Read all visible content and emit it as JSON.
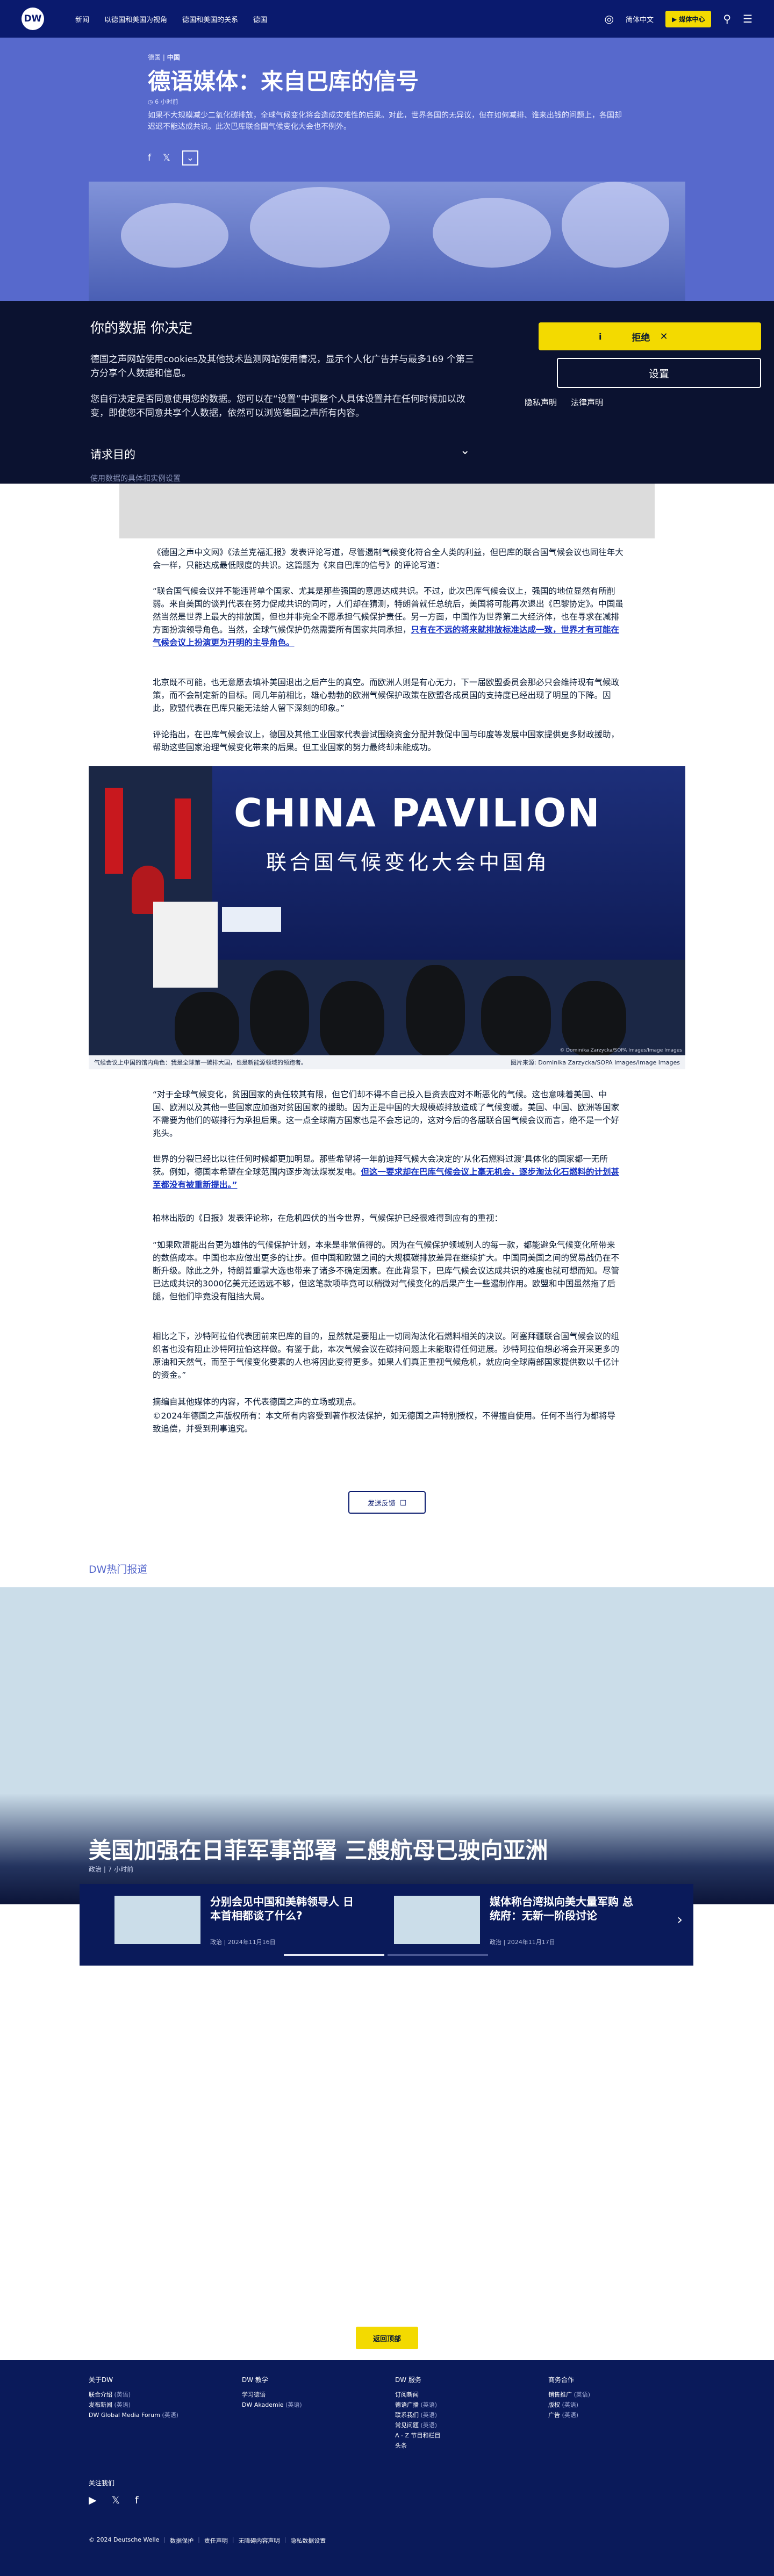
{
  "header": {
    "logo": "DW",
    "nav": [
      "新闻",
      "以德国和美国为视角",
      "德国和美国的关系",
      "德国"
    ],
    "lang_label": "简体中文",
    "media_center": "媒体中心"
  },
  "article": {
    "breadcrumb_section": "德国",
    "breadcrumb_region": "中国",
    "title": "德语媒体：来自巴库的信号",
    "time_ago": "6 小时前",
    "lead": "如果不大规模减少二氧化碳排放，全球气候变化将会造成灾难性的后果。对此，世界各国的无异议，但在如何减排、谁来出钱的问题上，各国却迟迟不能达成共识。此次巴库联合国气候变化大会也不例外。",
    "share_more": "更多",
    "para1": "《德国之声中文网》《法兰克福汇报》发表评论写道，尽管遏制气候变化符合全人类的利益，但巴库的联合国气候会议也同往年大会一样，只能达成最低限度的共识。这篇题为《来自巴库的信号》的评论写道：",
    "para2": "“联合国气候会议并不能违背单个国家、尤其是那些强国的意愿达成共识。不过，此次巴库气候会议上，强国的地位显然有所削弱。来自美国的谈判代表在努力促成共识的同时，人们却在猜测，特朗普就任总统后，美国将可能再次退出《巴黎协定》。中国虽然当然是世界上最大的排放国，但也并非完全不愿承担气候保护责任。另一方面，中国作为世界第二大经济体，也在寻求在减排方面扮演领导角色。当然，全球气候保护仍然需要所有国家共同承担，",
    "para2_link": "只有在不远的将来就排放标准达成一致，世界才有可能在气候会议上扮演更为开明的主导角色。",
    "para3": "北京既不可能，也无意愿去填补美国退出之后产生的真空。而欧洲人则是有心无力，下一届欧盟委员会那必只会维持现有气候政策，而不会制定新的目标。同几年前相比，雄心勃勃的欧洲气候保护政策在欧盟各成员国的支持度已经出现了明显的下降。因此，欧盟代表在巴库只能无法给人留下深刻的印象。”",
    "para4": "评论指出，在巴库气候会议上，德国及其他工业国家代表尝试围绕资金分配并敦促中国与印度等发展中国家提供更多财政援助，帮助这些国家治理气候变化带来的后果。但工业国家的努力最终却未能成功。",
    "photo_caption": "气候会议上中国的馆内角色：我是全球第一碳排大国，也是新能源领域的领跑者。",
    "photo_credit": "图片来源: Dominika Zarzycka/SOPA Images/Image Images",
    "image_credit_overlay": "© Dominika Zarzycka/SOPA Images/Image Images",
    "pavilion_title": "CHINA PAVILION",
    "pavilion_sub": "联合国气候变化大会中国角",
    "para5": "“对于全球气候变化，贫困国家的责任较其有限，但它们却不得不自己投入巨资去应对不断恶化的气候。这也意味着美国、中国、欧洲以及其他一些国家应加强对贫困国家的援助。因为正是中国的大规模碳排放造成了气候变暖。美国、中国、欧洲等国家不需要为他们的碳排行为承担后果。这一点全球南方国家也是不会忘记的，这对今后的各届联合国气候会议而言，绝不是一个好兆头。",
    "para6": "世界的分裂已经比以往任何时候都更加明显。那些希望将一年前迪拜气候大会决定的‘从化石燃料过渡’具体化的国家都一无所获。例如，德国本希望在全球范围内逐步淘汰煤炭发电。",
    "para6_link": "但这一要求却在巴库气候会议上毫无机会，逐步淘汰化石燃料的计划甚至都没有被重新提出。”",
    "para7": "柏林出版的《日报》发表评论称，在危机四伏的当今世界，气候保护已经很难得到应有的重视：",
    "para8": "“如果欧盟能出台更为雄伟的气候保护计划，本来是非常值得的。因为在气候保护领域别人的每一款，都能避免气候变化所带来的数倍成本。中国也本应做出更多的让步。但中国和欧盟之间的大规模碳排放差异在继续扩大。中国同美国之间的贸易战仍在不断升级。除此之外，特朗普重掌大选也带来了诸多不确定因素。在此背景下，巴库气候会议达成共识的难度也就可想而知。尽管已达成共识的3000亿美元还远远不够，但这笔款项毕竟可以稍微对气候变化的后果产生一些遏制作用。欧盟和中国虽然拖了后腿，但他们毕竟没有阻挡大局。",
    "para9": "相比之下，沙特阿拉伯代表团前来巴库的目的，显然就是要阻止一切同淘汰化石燃料相关的决议。阿塞拜疆联合国气候会议的组织者也没有阻止沙特阿拉伯这样做。有鉴于此，本次气候会议在碳排问题上未能取得任何进展。沙特阿拉伯想必将会开采更多的原油和天然气，而至于气候变化要素的人也将因此变得更多。如果人们真正重视气候危机，就应向全球南部国家提供数以千亿计的资金。”",
    "para10": "摘编自其他媒体的内容，不代表德国之声的立场或观点。",
    "copyright": "©2024年德国之声版权所有：本文所有内容受到著作权法保护，如无德国之声特别授权，不得擅自使用。任何不当行为都将导致追偿，并受到刑事追究。",
    "feedback_label": "发送反馈"
  },
  "hot": {
    "section_title": "DW热门报道",
    "headline": "美国加强在日菲军事部署 三艘航母已驶向亚洲",
    "meta": "政治 | 7 小时前",
    "cards": [
      {
        "title": "分别会见中国和美韩领导人 日本首相都谈了什么?",
        "meta": "政治 | 2024年11月16日"
      },
      {
        "title": "媒体称台湾拟向美大量军购 总统府：无新一阶段讨论",
        "meta": "政治 | 2024年11月17日"
      }
    ]
  },
  "back_to_top": "返回顶部",
  "cookie": {
    "title": "你的数据 你决定",
    "p1": "德国之声网站使用cookies及其他技术监测网站使用情况，显示个人化广告并与最多169 个第三方分享个人数据和信息。",
    "p2": "您自行决定是否同意使用您的数据。您可以在“设置”中调整个人具体设置并在任何时候加以改变，即使您不同意共享个人数据，依然可以浏览德国之声所有内容。",
    "purposes_label": "请求目的",
    "purposes_sub": "使用数据的具体和实例设置",
    "reject_label": "拒绝",
    "settings_label": "设置",
    "privacy_link": "隐私声明",
    "legal_link": "法律声明"
  },
  "footer": {
    "cols": [
      {
        "title": "关于DW",
        "items": [
          [
            "联合介绍",
            "(英语)"
          ],
          [
            "发布新闻",
            "(英语)"
          ],
          [
            "DW Global Media Forum",
            "(英语)"
          ]
        ]
      },
      {
        "title": "DW 教学",
        "items": [
          [
            "学习德语",
            ""
          ],
          [
            "DW Akademie",
            "(英语)"
          ]
        ]
      },
      {
        "title": "DW 服务",
        "items": [
          [
            "订阅新闻",
            ""
          ],
          [
            "德语广播",
            "(英语)"
          ],
          [
            "联系我们",
            "(英语)"
          ],
          [
            "常见问题",
            "(英语)"
          ],
          [
            "A - Z 节目和栏目",
            ""
          ],
          [
            "头条",
            ""
          ]
        ]
      },
      {
        "title": "商务合作",
        "items": [
          [
            "销售推广",
            "(英语)"
          ],
          [
            "版权",
            "(英语)"
          ],
          [
            "广告",
            "(英语)"
          ]
        ]
      }
    ],
    "follow_label": "关注我们",
    "legal": [
      "© 2024 Deutsche Welle",
      "数据保护",
      "责任声明",
      "无障碍内容声明",
      "隐私数据设置"
    ]
  }
}
